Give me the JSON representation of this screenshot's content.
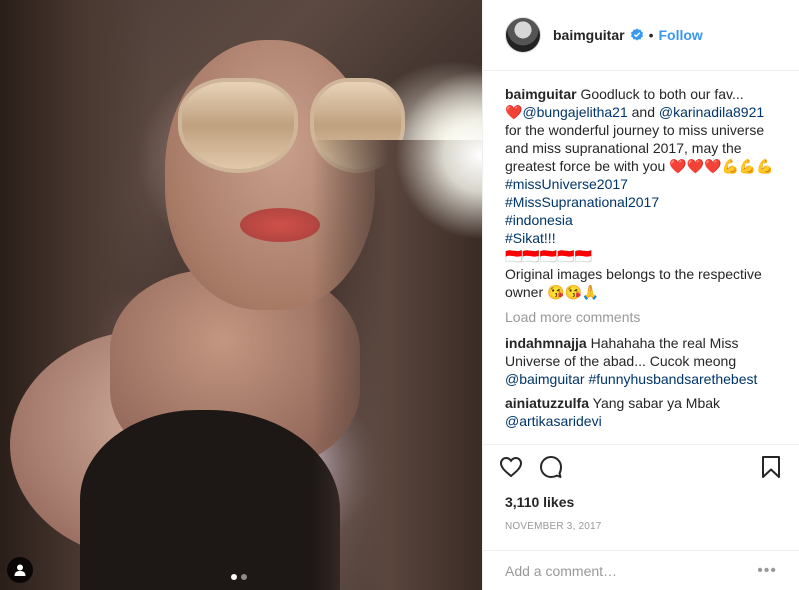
{
  "header": {
    "username": "baimguitar",
    "separator": "•",
    "follow_label": "Follow"
  },
  "caption": {
    "username": "baimguitar",
    "text_1": "Goodluck to both our fav...",
    "emoji_heart": "❤️",
    "mention_1": "@bungajelitha21",
    "text_and": "and",
    "mention_2": "@karinadila8921",
    "text_2": "for the wonderful journey to miss universe and miss supranational 2017, may the greatest force be with you",
    "emoji_row": "❤️❤️❤️💪💪💪",
    "hashtags": [
      "#missUniverse2017",
      "#MissSupranational2017",
      "#indonesia",
      "#Sikat!!!"
    ],
    "flags": "🇮🇩🇮🇩🇮🇩🇮🇩🇮🇩",
    "credit": "Original images belongs to the respective owner 😘😘🙏"
  },
  "load_more_label": "Load more comments",
  "comments": [
    {
      "username": "indahmnajja",
      "text": "Hahahaha the real Miss Universe of the abad... Cucok meong",
      "links": "@baimguitar #funnyhusbandsarethebest"
    },
    {
      "username": "ainiatuzzulfa",
      "text": "Yang sabar ya Mbak",
      "links": "@artikasaridevi"
    }
  ],
  "icons": {
    "like": "heart-icon",
    "comment": "comment-icon",
    "save": "bookmark-icon",
    "verified": "verified-badge-icon",
    "user_tag": "user-tag-icon"
  },
  "likes_label": "3,110 likes",
  "date_label": "NOVEMBER 3, 2017",
  "add_comment_placeholder": "Add a comment…",
  "more_label": "•••",
  "carousel": {
    "count": 2,
    "active_index": 0
  },
  "colors": {
    "accent": "#3897f0",
    "link": "#003569",
    "muted": "#999999"
  }
}
